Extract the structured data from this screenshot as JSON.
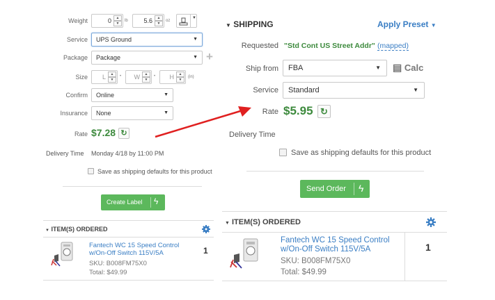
{
  "left": {
    "weight": {
      "label": "Weight",
      "lb_value": "0",
      "lb_unit": "lb",
      "oz_value": "5.6",
      "oz_unit": "oz"
    },
    "service": {
      "label": "Service",
      "value": "UPS Ground"
    },
    "package": {
      "label": "Package",
      "value": "Package"
    },
    "size": {
      "label": "Size",
      "length_placeholder": "L",
      "width_placeholder": "W",
      "height_placeholder": "H",
      "unit": "(in)"
    },
    "confirm": {
      "label": "Confirm",
      "value": "Online"
    },
    "insurance": {
      "label": "Insurance",
      "value": "None"
    },
    "rate": {
      "label": "Rate",
      "value": "$7.28"
    },
    "delivery": {
      "label": "Delivery Time",
      "value": "Monday 4/18 by 11:00 PM"
    },
    "save_defaults": "Save as shipping defaults for this product",
    "create_label": "Create Label",
    "items_header": "ITEM(S) ORDERED",
    "item": {
      "title_line1": "Fantech WC 15 Speed Control",
      "title_line2": "w/On-Off Switch 115V/5A",
      "sku": "SKU: B008FM75X0",
      "total": "Total: $49.99",
      "qty": "1"
    }
  },
  "right": {
    "header": "SHIPPING",
    "apply_preset": "Apply Preset",
    "requested": {
      "label": "Requested",
      "value": "\"Std Cont US Street Addr\"",
      "mapped": "(mapped)"
    },
    "ship_from": {
      "label": "Ship from",
      "value": "FBA",
      "calc": "Calc"
    },
    "service": {
      "label": "Service",
      "value": "Standard"
    },
    "rate": {
      "label": "Rate",
      "value": "$5.95"
    },
    "delivery": {
      "label": "Delivery Time"
    },
    "save_defaults": "Save as shipping defaults for this product",
    "send_order": "Send Order",
    "items_header": "ITEM(S) ORDERED",
    "item": {
      "title_line1": "Fantech WC 15 Speed Control",
      "title_line2": "w/On-Off Switch 115V/5A",
      "sku": "SKU: B008FM75X0",
      "total": "Total: $49.99",
      "qty": "1"
    }
  },
  "colors": {
    "accent_green": "#5cb85c",
    "rate_green": "#3d8a3d",
    "link_blue": "#3a7ec4",
    "arrow_red": "#e02020"
  }
}
